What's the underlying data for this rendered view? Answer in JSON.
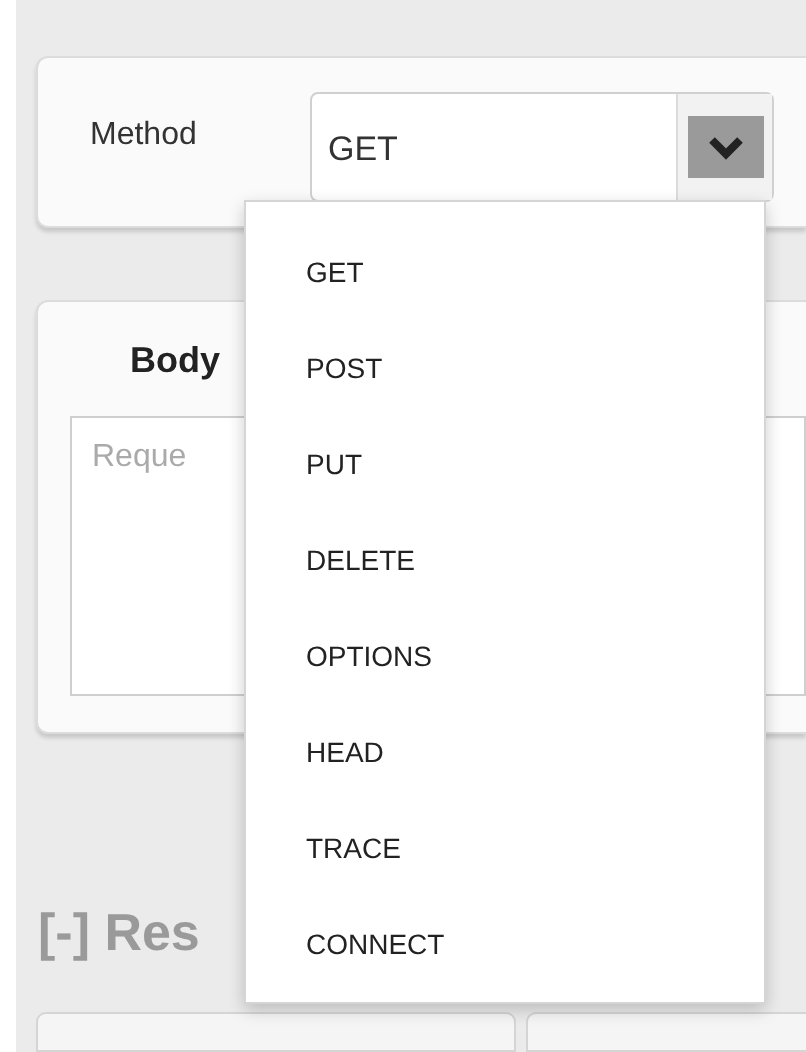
{
  "method": {
    "label": "Method",
    "value": "GET"
  },
  "menu": {
    "items": [
      "GET",
      "POST",
      "PUT",
      "DELETE",
      "OPTIONS",
      "HEAD",
      "TRACE",
      "CONNECT"
    ]
  },
  "body": {
    "title": "Body",
    "placeholder": "Reque"
  },
  "response": {
    "heading": "[-] Res"
  }
}
